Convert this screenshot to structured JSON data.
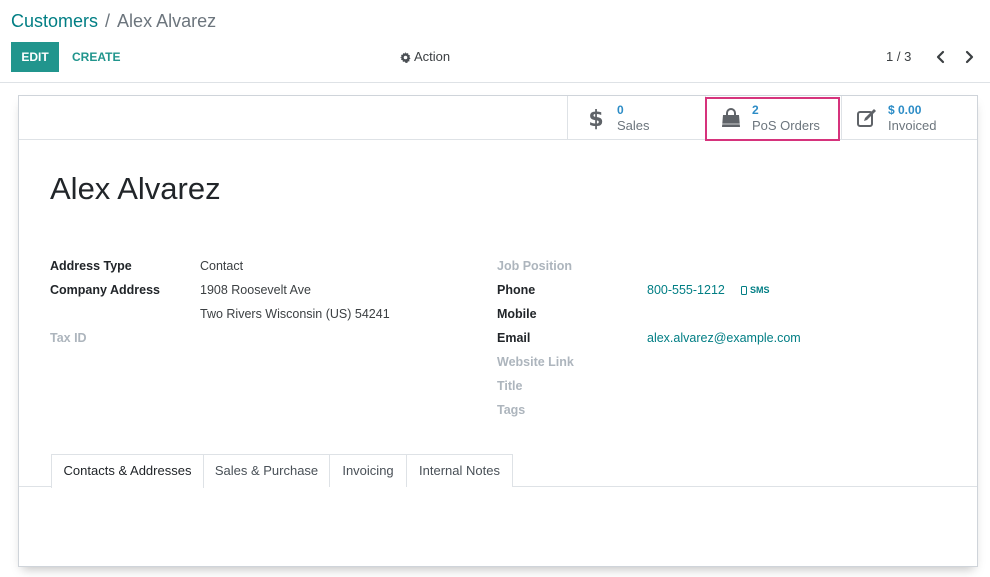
{
  "breadcrumb": {
    "parent": "Customers",
    "separator": "/",
    "current": "Alex Alvarez"
  },
  "toolbar": {
    "edit_label": "EDIT",
    "create_label": "CREATE",
    "action_label": "Action"
  },
  "pager": {
    "value": "1 / 3"
  },
  "stats": {
    "sales": {
      "value": "0",
      "label": "Sales"
    },
    "pos": {
      "value": "2",
      "label": "PoS Orders"
    },
    "invoiced": {
      "value": "$ 0.00",
      "label": "Invoiced"
    }
  },
  "partner": {
    "name": "Alex Alvarez"
  },
  "fields": {
    "address_type": {
      "label": "Address Type",
      "value": "Contact"
    },
    "company_address": {
      "label": "Company Address",
      "street": "1908 Roosevelt Ave",
      "city_line": "Two Rivers  Wisconsin (US)  54241"
    },
    "tax_id": {
      "label": "Tax ID"
    },
    "job_position": {
      "label": "Job Position"
    },
    "phone": {
      "label": "Phone",
      "value": "800-555-1212",
      "sms": "SMS"
    },
    "mobile": {
      "label": "Mobile"
    },
    "email": {
      "label": "Email",
      "value": "alex.alvarez@example.com"
    },
    "website": {
      "label": "Website Link"
    },
    "title": {
      "label": "Title"
    },
    "tags": {
      "label": "Tags"
    }
  },
  "tabs": [
    "Contacts & Addresses",
    "Sales & Purchase",
    "Invoicing",
    "Internal Notes"
  ],
  "colors": {
    "brand": "#21958d",
    "link": "#017e84",
    "stat_value": "#2c8cc6",
    "highlight": "#d6337c"
  },
  "icons": {
    "action": "gear-icon",
    "sales": "dollar-icon",
    "pos": "shopping-bag-icon",
    "invoiced": "pencil-square-icon",
    "sms": "mobile-icon"
  }
}
